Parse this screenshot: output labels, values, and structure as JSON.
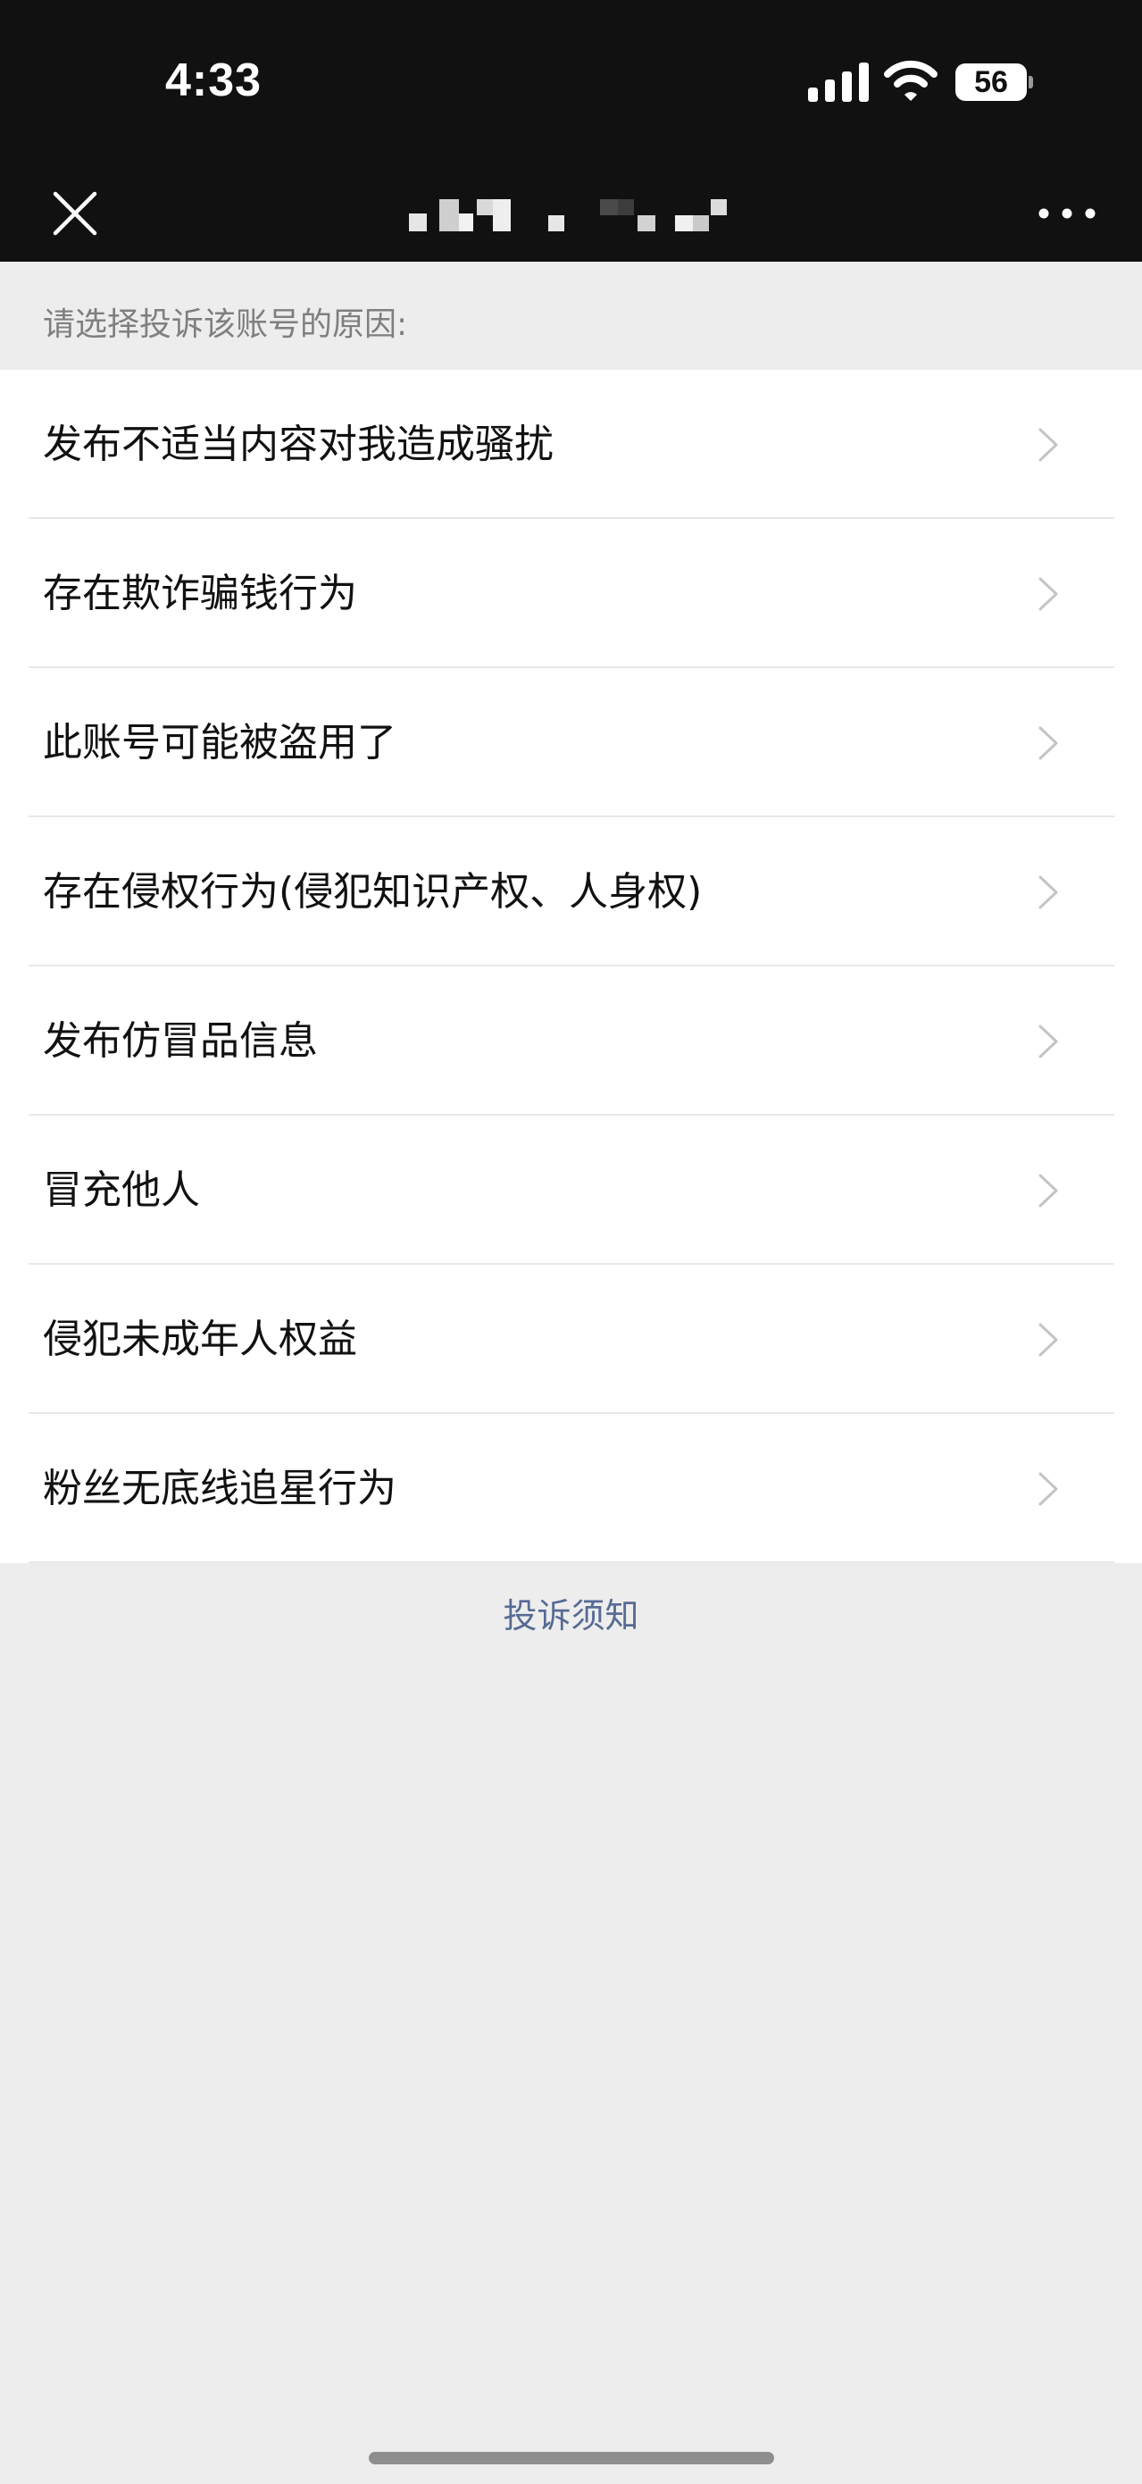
{
  "status_bar": {
    "time": "4:33",
    "battery_level": "56",
    "icons": [
      "signal-icon",
      "wifi-icon",
      "battery-icon"
    ]
  },
  "nav": {
    "title": "",
    "title_pixelated": true,
    "left_icon": "close-icon",
    "right_icon": "more-icon"
  },
  "page": {
    "hint": "请选择投诉该账号的原因:",
    "reasons": [
      {
        "label": "发布不适当内容对我造成骚扰"
      },
      {
        "label": "存在欺诈骗钱行为"
      },
      {
        "label": "此账号可能被盗用了"
      },
      {
        "label": "存在侵权行为(侵犯知识产权、人身权)"
      },
      {
        "label": "发布仿冒品信息"
      },
      {
        "label": "冒充他人"
      },
      {
        "label": "侵犯未成年人权益"
      },
      {
        "label": "粉丝无底线追星行为"
      }
    ],
    "notice_link": "投诉须知"
  },
  "colors": {
    "bar_background": "#111111",
    "page_background": "#ededed",
    "link": "#576b95",
    "hint_text": "#7f7f7f"
  }
}
